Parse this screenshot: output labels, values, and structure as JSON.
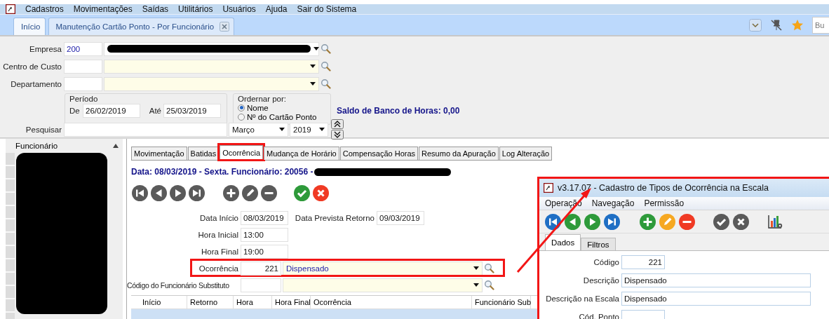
{
  "menu": [
    "Cadastros",
    "Movimentações",
    "Saídas",
    "Utilitários",
    "Usuários",
    "Ajuda",
    "Sair do Sistema"
  ],
  "tabs": [
    {
      "label": "Início",
      "selected": false
    },
    {
      "label": "Manutenção Cartão Ponto - Por Funcionário",
      "selected": true
    }
  ],
  "quick_search": {
    "placeholder": "Bu"
  },
  "filters": {
    "empresa": {
      "label": "Empresa",
      "code": "200"
    },
    "centro_custo": {
      "label": "Centro de Custo"
    },
    "departamento": {
      "label": "Departamento"
    },
    "periodo": {
      "title": "Período",
      "de_label": "De",
      "de": "26/02/2019",
      "ate_label": "Até",
      "ate": "25/03/2019"
    },
    "ordenar": {
      "title": "Ordernar por:",
      "options": [
        {
          "label": "Nome",
          "selected": true
        },
        {
          "label": "Nº do Cartão Ponto",
          "selected": false
        }
      ]
    },
    "saldo": "Saldo de Banco de Horas: 0,00",
    "pesquisar": {
      "label": "Pesquisar",
      "month": "Março",
      "year": "2019"
    }
  },
  "employee_panel": {
    "header": "Funcionário"
  },
  "detail_tabs": [
    {
      "label": "Movimentação",
      "selected": false
    },
    {
      "label": "Batidas",
      "selected": false
    },
    {
      "label": "Ocorrência",
      "selected": true
    },
    {
      "label": "Mudança de Horário",
      "selected": false
    },
    {
      "label": "Compensação Horas",
      "selected": false
    },
    {
      "label": "Resumo da Apuração",
      "selected": false
    },
    {
      "label": "Log Alteração",
      "selected": false
    }
  ],
  "detail_header": "Data: 08/03/2019 - Sexta. Funcionário: 20056 -",
  "toolbar": [
    {
      "kind": "first",
      "color": "#5a5a5a"
    },
    {
      "kind": "prev",
      "color": "#5a5a5a"
    },
    {
      "kind": "next",
      "color": "#5a5a5a"
    },
    {
      "kind": "last",
      "color": "#5a5a5a"
    },
    {
      "kind": "add",
      "color": "#5a5a5a"
    },
    {
      "kind": "edit",
      "color": "#5a5a5a"
    },
    {
      "kind": "remove",
      "color": "#5a5a5a"
    },
    {
      "kind": "confirm",
      "color": "#2e9a3a"
    },
    {
      "kind": "cancel",
      "color": "#f03a24"
    }
  ],
  "fields": {
    "data_inicio": {
      "label": "Data Início",
      "value": "08/03/2019"
    },
    "data_retorno": {
      "label": "Data Prevista Retorno",
      "value": "09/03/2019"
    },
    "hora_inicial": {
      "label": "Hora Inicial",
      "value": "13:00"
    },
    "hora_final": {
      "label": "Hora Final",
      "value": "19:00"
    },
    "ocorrencia": {
      "label": "Ocorrência",
      "code": "221",
      "description": "Dispensado"
    },
    "substituto": {
      "label": "Código do Funcionário Substituto"
    }
  },
  "grid": {
    "columns": [
      "Início",
      "Retorno",
      "Hora",
      "Hora Final",
      "Ocorrência",
      "Funcionário Sub"
    ]
  },
  "dialog": {
    "title": "v3.17.07 - Cadastro de Tipos de Ocorrência na Escala",
    "menu": [
      "Operação",
      "Navegação",
      "Permissão"
    ],
    "toolbar": [
      {
        "kind": "first",
        "color": "#1f6fc4"
      },
      {
        "kind": "prev",
        "color": "#2e9a3a"
      },
      {
        "kind": "next",
        "color": "#2e9a3a"
      },
      {
        "kind": "last",
        "color": "#1f6fc4"
      },
      {
        "kind": "add",
        "color": "#2e9a3a"
      },
      {
        "kind": "edit",
        "color": "#f6a821"
      },
      {
        "kind": "remove",
        "color": "#f03a24"
      },
      {
        "kind": "confirm",
        "color": "#5a5a5a"
      },
      {
        "kind": "cancel",
        "color": "#5a5a5a"
      },
      {
        "kind": "chart"
      }
    ],
    "tabs": [
      {
        "label": "Dados",
        "selected": true
      },
      {
        "label": "Filtros",
        "selected": false
      }
    ],
    "fields": [
      {
        "label": "Código",
        "value": "221",
        "kind": "code"
      },
      {
        "label": "Descrição",
        "value": "Dispensado",
        "kind": "wide"
      },
      {
        "label": "Descrição na Escala",
        "value": "Dispensado",
        "kind": "wide"
      },
      {
        "label": "Cód. Ponto",
        "kind": "code"
      }
    ]
  }
}
